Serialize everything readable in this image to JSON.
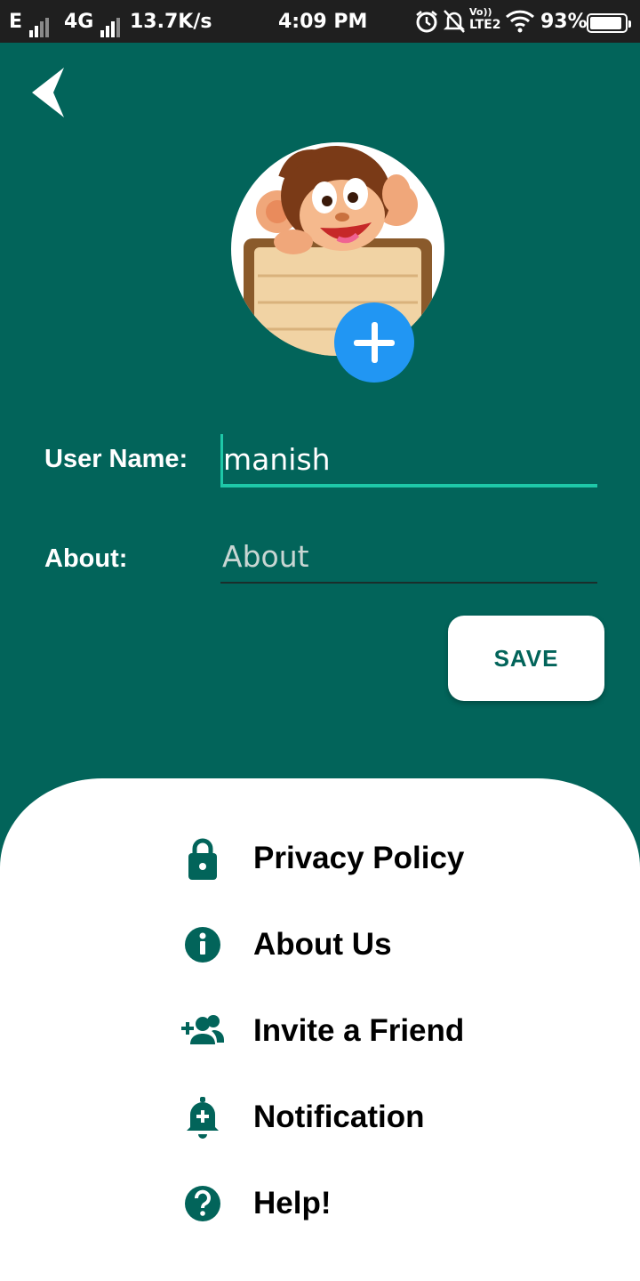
{
  "status_bar": {
    "network_type": "E",
    "network_type2": "4G",
    "speed": "13.7K/s",
    "time": "4:09 PM",
    "volte": "Vo))",
    "lte": "LTE2",
    "battery": "93%",
    "battery_level": 0.93
  },
  "profile": {
    "avatar_icon": "monkey-avatar",
    "add_photo_icon": "plus-icon"
  },
  "form": {
    "username_label": "User Name:",
    "username_value": "manish",
    "about_label": "About:",
    "about_placeholder": "About",
    "about_value": "",
    "save_label": "SAVE"
  },
  "menu": {
    "items": [
      {
        "label": "Privacy Policy",
        "icon": "lock-icon"
      },
      {
        "label": "About Us",
        "icon": "info-icon"
      },
      {
        "label": "Invite a Friend",
        "icon": "add-people-icon"
      },
      {
        "label": "Notification",
        "icon": "bell-plus-icon"
      },
      {
        "label": "Help!",
        "icon": "help-icon"
      }
    ]
  },
  "colors": {
    "primary": "#02645a",
    "accent": "#1ec8a8",
    "fab": "#2196f3",
    "status_bar": "#1f1f1f"
  }
}
